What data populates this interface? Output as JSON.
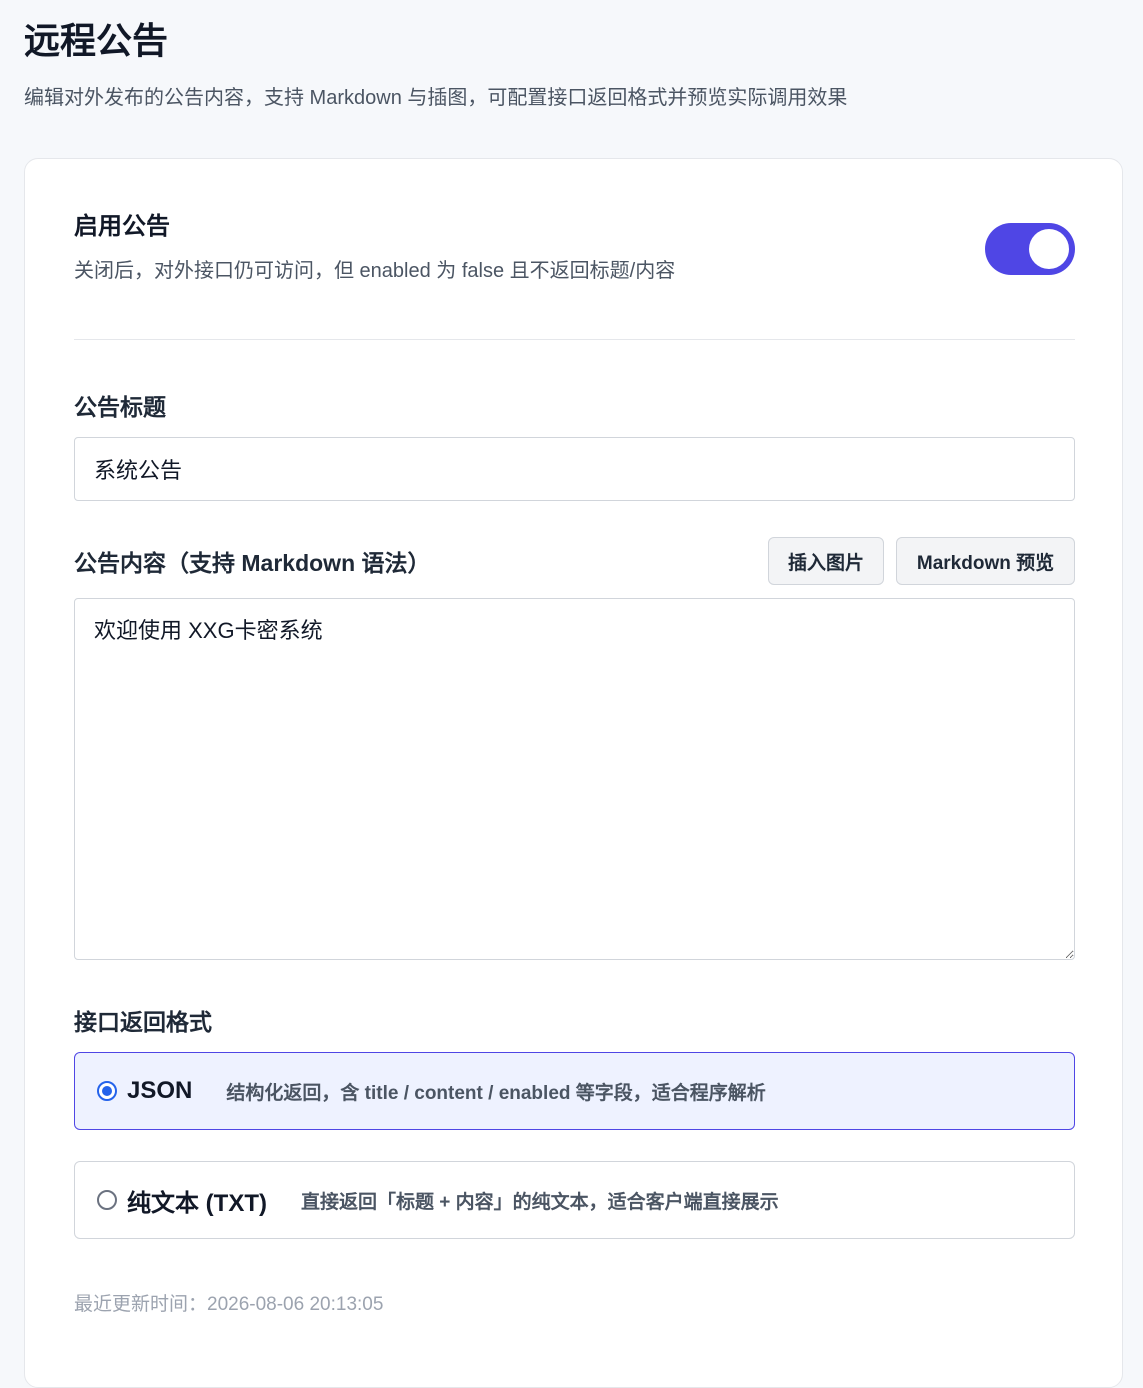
{
  "header": {
    "title": "远程公告",
    "subtitle": "编辑对外发布的公告内容，支持 Markdown 与插图，可配置接口返回格式并预览实际调用效果"
  },
  "enable": {
    "title": "启用公告",
    "description": "关闭后，对外接口仍可访问，但 enabled 为 false 且不返回标题/内容",
    "value": true
  },
  "title_field": {
    "label": "公告标题",
    "value": "系统公告"
  },
  "content_field": {
    "label": "公告内容（支持 Markdown 语法）",
    "value": "欢迎使用 XXG卡密系统",
    "insert_image_label": "插入图片",
    "preview_label": "Markdown 预览"
  },
  "format": {
    "label": "接口返回格式",
    "selected": "json",
    "options": [
      {
        "name": "JSON",
        "description": "结构化返回，含 title / content / enabled 等字段，适合程序解析"
      },
      {
        "name": "纯文本 (TXT)",
        "description": "直接返回「标题 + 内容」的纯文本，适合客户端直接展示"
      }
    ]
  },
  "updated": {
    "text": "最近更新时间：2026-08-06 20:13:05"
  },
  "colors": {
    "accent": "#4f46e5",
    "radio_checked": "#2563eb",
    "selected_option_bg": "#eef2ff"
  }
}
